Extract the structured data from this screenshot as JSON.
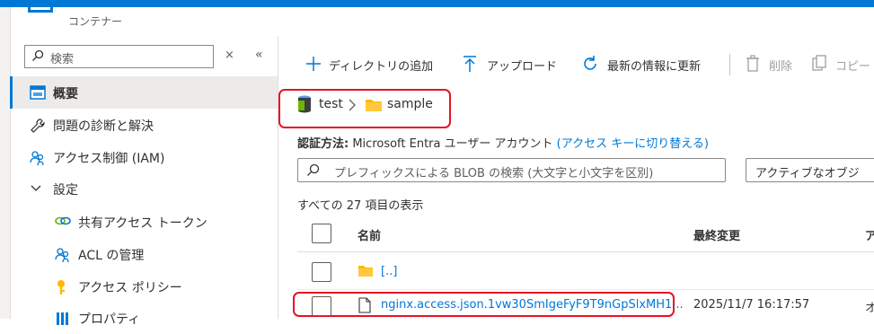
{
  "header": {
    "subtitle": "コンテナー"
  },
  "sidebar": {
    "search_placeholder": "検索",
    "clear_glyph": "×",
    "collapse_glyph": "«",
    "items": [
      {
        "label": "概要",
        "icon": "overview-icon",
        "selected": true
      },
      {
        "label": "問題の診断と解決",
        "icon": "wrench-icon"
      },
      {
        "label": "アクセス制御 (IAM)",
        "icon": "people-icon"
      },
      {
        "label": "設定",
        "icon": "chevron-down-icon",
        "expanded": true
      },
      {
        "label": "共有アクセス トークン",
        "icon": "link-icon"
      },
      {
        "label": "ACL の管理",
        "icon": "people-icon"
      },
      {
        "label": "アクセス ポリシー",
        "icon": "key-icon"
      },
      {
        "label": "プロパティ",
        "icon": "properties-icon"
      }
    ]
  },
  "toolbar": {
    "add_directory": "ディレクトリの追加",
    "upload": "アップロード",
    "refresh": "最新の情報に更新",
    "delete": "削除",
    "copy": "コピー"
  },
  "breadcrumb": {
    "container": "test",
    "folder": "sample"
  },
  "auth": {
    "label": "認証方法:",
    "value": "Microsoft Entra ユーザー アカウント",
    "switch_link": "(アクセス キーに切り替える)"
  },
  "filter": {
    "placeholder": "プレフィックスによる BLOB の検索 (大文字と小文字を区別)",
    "dropdown_value": "アクティブなオブジ"
  },
  "list": {
    "count_text": "すべての 27 項目の表示",
    "columns": {
      "name": "名前",
      "modified": "最終変更",
      "extra": "ア"
    },
    "rows": [
      {
        "name": "[..]",
        "type": "folder",
        "modified": ""
      },
      {
        "name": "nginx.access.json.1vw30SmIgeFyF9T9nGpSlxMH1...",
        "type": "file",
        "modified": "2025/11/7 16:17:57",
        "extra": "オ"
      }
    ]
  },
  "colors": {
    "accent": "#0078d4",
    "highlight": "#e81123",
    "folder": "#ffb900"
  }
}
